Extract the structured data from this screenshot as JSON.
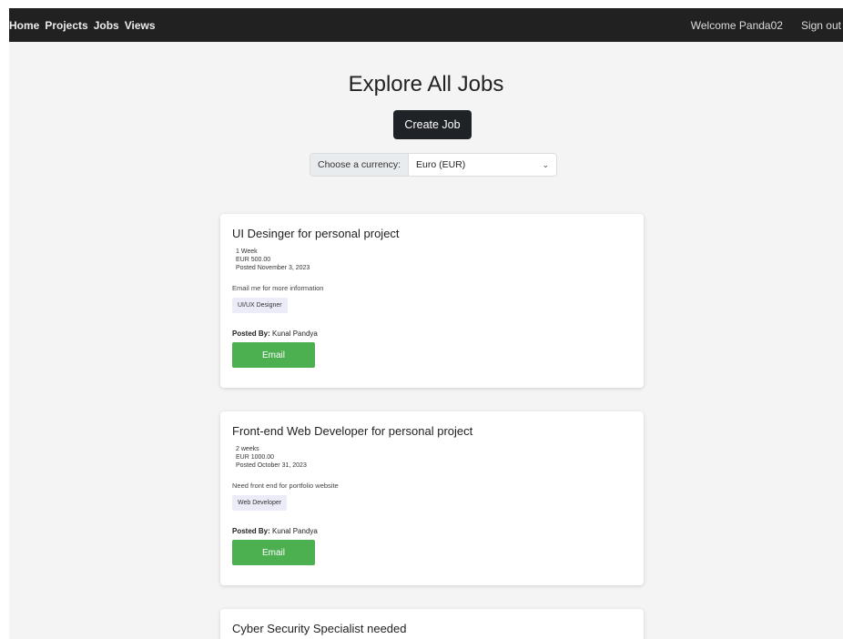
{
  "nav": {
    "home": "Home",
    "projects": "Projects",
    "jobs": "Jobs",
    "views": "Views",
    "welcome": "Welcome Panda02",
    "signout": "Sign out"
  },
  "page": {
    "title": "Explore All Jobs",
    "create_job": "Create Job",
    "currency_label": "Choose a currency:",
    "currency_value": "Euro (EUR)"
  },
  "jobs": [
    {
      "title": "UI Desinger for personal project",
      "duration": "1 Week",
      "price": "EUR 500.00",
      "posted": "Posted November 3, 2023",
      "description": "Email me for more information",
      "tag": "UI/UX Designer",
      "posted_by_label": "Posted By:",
      "posted_by": "Kunal Pandya",
      "button": "Email"
    },
    {
      "title": "Front-end Web Developer for personal project",
      "duration": "2 weeks",
      "price": "EUR 1000.00",
      "posted": "Posted October 31, 2023",
      "description": "Need front end for portfolio website",
      "tag": "Web Developer",
      "posted_by_label": "Posted By:",
      "posted_by": "Kunal Pandya",
      "button": "Email"
    },
    {
      "title": "Cyber Security Specialist needed"
    }
  ]
}
